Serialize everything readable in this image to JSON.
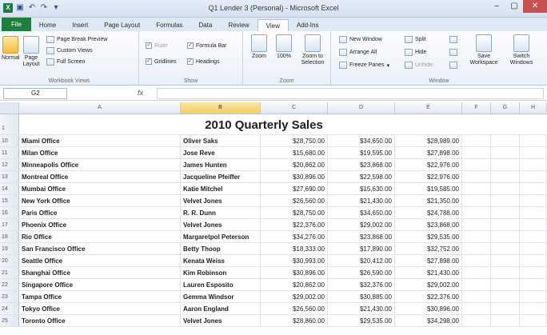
{
  "window": {
    "title": "Q1 Lender 3 (Personal) - Microsoft Excel",
    "qat": [
      "save-icon",
      "undo-icon",
      "redo-icon",
      "customize-icon"
    ],
    "controls": [
      "–",
      "▢",
      "✕"
    ]
  },
  "tabs": [
    "File",
    "Home",
    "Insert",
    "Page Layout",
    "Formulas",
    "Data",
    "Review",
    "View",
    "Add-Ins"
  ],
  "active_tab": "View",
  "ribbon": {
    "workbook_views": {
      "label": "Workbook Views",
      "normal": "Normal",
      "page_layout": "Page Layout",
      "page_break_preview": "Page Break Preview",
      "custom_views": "Custom Views",
      "full_screen": "Full Screen"
    },
    "show": {
      "label": "Show",
      "ruler": "Ruler",
      "formula_bar": "Formula Bar",
      "gridlines": "Gridlines",
      "headings": "Headings"
    },
    "zoom": {
      "label": "Zoom",
      "zoom": "Zoom",
      "hundred": "100%",
      "zoom_to_selection": "Zoom to Selection"
    },
    "window": {
      "label": "Window",
      "new_window": "New Window",
      "arrange_all": "Arrange All",
      "freeze_panes": "Freeze Panes",
      "split": "Split",
      "hide": "Hide",
      "unhide": "Unhide",
      "save_workspace": "Save Workspace",
      "switch_windows": "Switch Windows"
    }
  },
  "formula_bar": {
    "name_box": "G2",
    "fx": "fx",
    "content": ""
  },
  "columns": [
    "A",
    "B",
    "C",
    "D",
    "E",
    "F",
    "G",
    "H"
  ],
  "selected_column": "B",
  "sheet": {
    "title_row_num": "1",
    "title": "2010 Quarterly Sales",
    "rows": [
      {
        "n": "10",
        "office": "Miami Office",
        "rep": "Oliver Saks",
        "c": "$28,750.00",
        "d": "$34,650.00",
        "e": "$28,989.00"
      },
      {
        "n": "11",
        "office": "Milan Office",
        "rep": "Jose Reve",
        "c": "$15,680.00",
        "d": "$19,595.00",
        "e": "$27,898.00"
      },
      {
        "n": "12",
        "office": "Minneapolis Office",
        "rep": "James Hunten",
        "c": "$20,862.00",
        "d": "$23,868.00",
        "e": "$22,976.00"
      },
      {
        "n": "13",
        "office": "Montreal Office",
        "rep": "Jacqueline Pfeiffer",
        "c": "$30,896.00",
        "d": "$22,598.00",
        "e": "$22,976.00"
      },
      {
        "n": "14",
        "office": "Mumbai Office",
        "rep": "Katie Mitchel",
        "c": "$27,690.00",
        "d": "$15,630.00",
        "e": "$19,585.00"
      },
      {
        "n": "15",
        "office": "New York Office",
        "rep": "Velvet Jones",
        "c": "$26,560.00",
        "d": "$21,430.00",
        "e": "$21,350.00"
      },
      {
        "n": "16",
        "office": "Paris Office",
        "rep": "R. R. Dunn",
        "c": "$28,750.00",
        "d": "$34,650.00",
        "e": "$24,788.00"
      },
      {
        "n": "17",
        "office": "Phoenix Office",
        "rep": "Velvet Jones",
        "c": "$22,376.00",
        "d": "$29,002.00",
        "e": "$23,868.00"
      },
      {
        "n": "18",
        "office": "Rio Office",
        "rep": "Margaretpol Peterson",
        "c": "$34,276.00",
        "d": "$23,868.00",
        "e": "$29,535.00"
      },
      {
        "n": "19",
        "office": "San Francisco Office",
        "rep": "Betty Thoop",
        "c": "$18,333.00",
        "d": "$17,890.00",
        "e": "$32,752.00"
      },
      {
        "n": "20",
        "office": "Seattle Office",
        "rep": "Kenata Weiss",
        "c": "$30,993.00",
        "d": "$20,412.00",
        "e": "$27,898.00"
      },
      {
        "n": "21",
        "office": "Shanghai Office",
        "rep": "Kim Robinson",
        "c": "$30,896.00",
        "d": "$26,590.00",
        "e": "$21,430.00"
      },
      {
        "n": "22",
        "office": "Singapore Office",
        "rep": "Lauren Esposito",
        "c": "$20,862.00",
        "d": "$32,376.00",
        "e": "$29,002.00"
      },
      {
        "n": "23",
        "office": "Tampa Office",
        "rep": "Gemma Windsor",
        "c": "$29,002.00",
        "d": "$30,885.00",
        "e": "$22,376.00"
      },
      {
        "n": "24",
        "office": "Tokyo Office",
        "rep": "Aaron England",
        "c": "$26,560.00",
        "d": "$21,430.00",
        "e": "$30,896.00"
      },
      {
        "n": "25",
        "office": "Toronto Office",
        "rep": "Velvet Jones",
        "c": "$28,860.00",
        "d": "$29,535.00",
        "e": "$34,298.00"
      }
    ]
  },
  "colors": {
    "file_tab": "#1f7d3f",
    "selected_header": "#f6cd66",
    "ribbon_bg": "#e9f0f8"
  }
}
